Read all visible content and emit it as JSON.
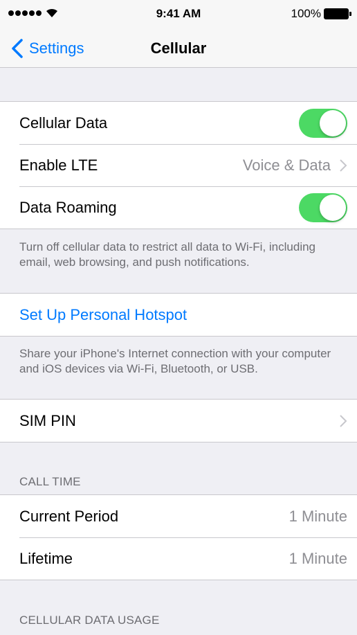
{
  "status_bar": {
    "time": "9:41 AM",
    "battery_percent": "100%",
    "signal_bars": 5,
    "wifi_icon": "wifi-icon",
    "battery_level": 1.0
  },
  "nav": {
    "back_label": "Settings",
    "title": "Cellular"
  },
  "colors": {
    "accent": "#007aff",
    "toggle_on": "#4cd964",
    "background": "#efeff4",
    "secondary_text": "#8e8e93"
  },
  "cellular_group": {
    "cellular_data": {
      "label": "Cellular Data",
      "enabled": true
    },
    "enable_lte": {
      "label": "Enable LTE",
      "value": "Voice & Data"
    },
    "data_roaming": {
      "label": "Data Roaming",
      "enabled": true
    }
  },
  "cellular_footer": "Turn off cellular data to restrict all data to Wi-Fi, including email, web browsing, and push notifications.",
  "hotspot": {
    "label": "Set Up Personal Hotspot"
  },
  "hotspot_footer": "Share your iPhone's Internet connection with your computer and iOS devices via Wi-Fi, Bluetooth, or USB.",
  "sim_pin": {
    "label": "SIM PIN"
  },
  "call_time": {
    "header": "CALL TIME",
    "current_period": {
      "label": "Current Period",
      "value": "1 Minute"
    },
    "lifetime": {
      "label": "Lifetime",
      "value": "1 Minute"
    }
  },
  "cellular_data_usage": {
    "header": "CELLULAR DATA USAGE"
  }
}
